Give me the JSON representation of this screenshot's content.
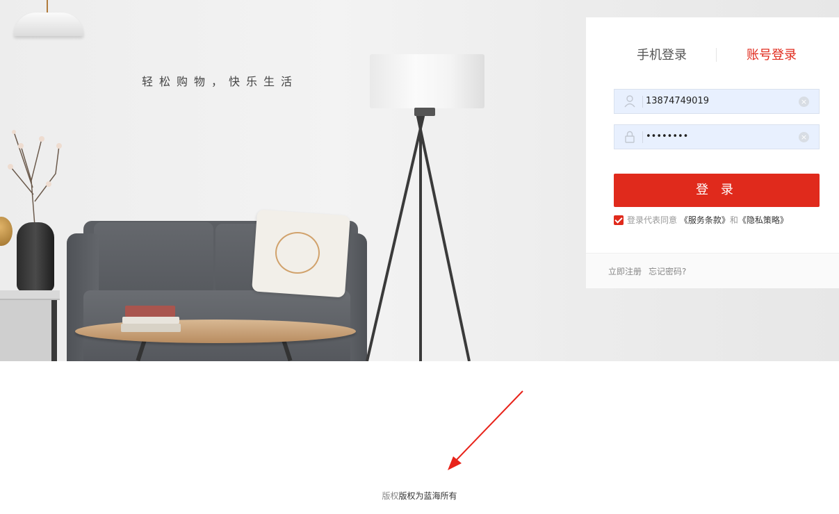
{
  "banner": {
    "slogan": "轻松购物，快乐生活"
  },
  "login": {
    "tabs": [
      {
        "label": "手机登录",
        "active": false
      },
      {
        "label": "账号登录",
        "active": true
      }
    ],
    "username": {
      "value": "13874749019",
      "icon": "user-icon",
      "clear_icon": "clear-icon"
    },
    "password": {
      "value": "••••••••",
      "icon": "lock-icon",
      "clear_icon": "clear-icon"
    },
    "submit_label": "登 录",
    "agreement": {
      "checked": true,
      "prefix": "登录代表同意",
      "terms_link": "《服务条款》",
      "conjunction": "和",
      "privacy_link": "《隐私策略》"
    },
    "footer": {
      "register_link": "立即注册",
      "forgot_link": "忘记密码?"
    }
  },
  "footer": {
    "copyright_prefix": "版权",
    "copyright_main": "版权为蓝海所有"
  },
  "colors": {
    "accent": "#e02a1c",
    "input_bg": "#e8f0fe"
  }
}
